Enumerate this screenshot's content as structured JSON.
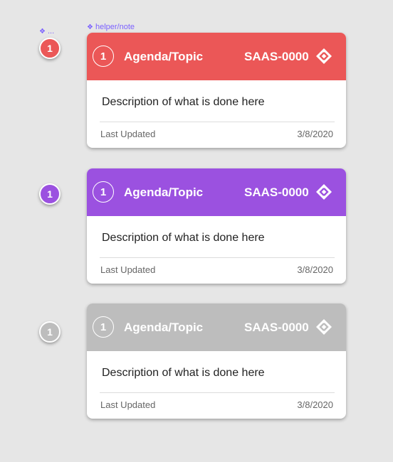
{
  "top_helper": {
    "glyph": "❖",
    "text": "..."
  },
  "card_helper": {
    "glyph": "❖",
    "text": "helper/note"
  },
  "cards": [
    {
      "color": "#eb5757",
      "badge": "1",
      "number": "1",
      "topic": "Agenda/Topic",
      "ticket": "SAAS-0000",
      "icon": "jira-diamond-icon",
      "description": "Description of what is done here",
      "updated_label": "Last Updated",
      "updated_date": "3/8/2020"
    },
    {
      "color": "#9b51e0",
      "badge": "1",
      "number": "1",
      "topic": "Agenda/Topic",
      "ticket": "SAAS-0000",
      "icon": "jira-diamond-icon",
      "description": "Description of what is done here",
      "updated_label": "Last Updated",
      "updated_date": "3/8/2020"
    },
    {
      "color": "#bdbdbd",
      "badge": "1",
      "number": "1",
      "topic": "Agenda/Topic",
      "ticket": "SAAS-0000",
      "icon": "jira-diamond-icon",
      "description": "Description of what is done here",
      "updated_label": "Last Updated",
      "updated_date": "3/8/2020"
    }
  ]
}
